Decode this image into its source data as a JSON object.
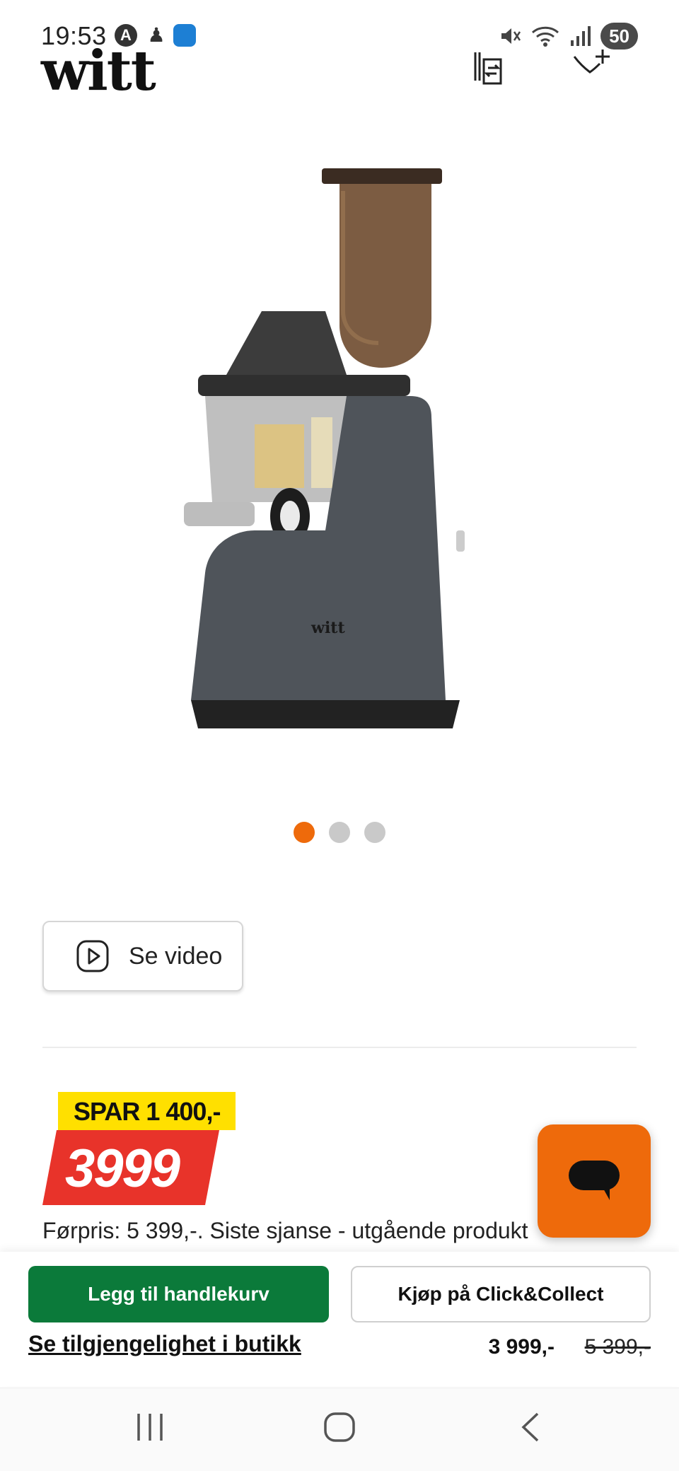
{
  "status_bar": {
    "time": "19:53",
    "battery": "50"
  },
  "header": {
    "logo": "witt"
  },
  "product": {
    "image_logo": "witt",
    "carousel": {
      "total": 3,
      "active_index": 0
    },
    "video_button_label": "Se video"
  },
  "price": {
    "save_label": "SPAR 1 400,-",
    "current": "3999",
    "previous_note": "Førpris: 5 399,-. Siste sjanse - utgående produkt"
  },
  "bottom_bar": {
    "add_to_cart": "Legg til handlekurv",
    "click_collect": "Kjøp på Click&Collect",
    "availability": "Se tilgjengelighet i butikk",
    "price": "3 999,-",
    "old_price": "5 399,-"
  },
  "colors": {
    "accent_orange": "#ee6a0b",
    "price_red": "#e8332a",
    "save_yellow": "#ffe000",
    "cart_green": "#0b7a3a"
  },
  "icons": {
    "status": [
      "avatar-icon",
      "notification-icon",
      "app-icon",
      "mute-icon",
      "wifi-icon",
      "signal-icon"
    ],
    "header": [
      "compare-icon",
      "favorite-add-icon"
    ],
    "nav": [
      "recent-apps-icon",
      "home-icon",
      "back-icon"
    ]
  }
}
